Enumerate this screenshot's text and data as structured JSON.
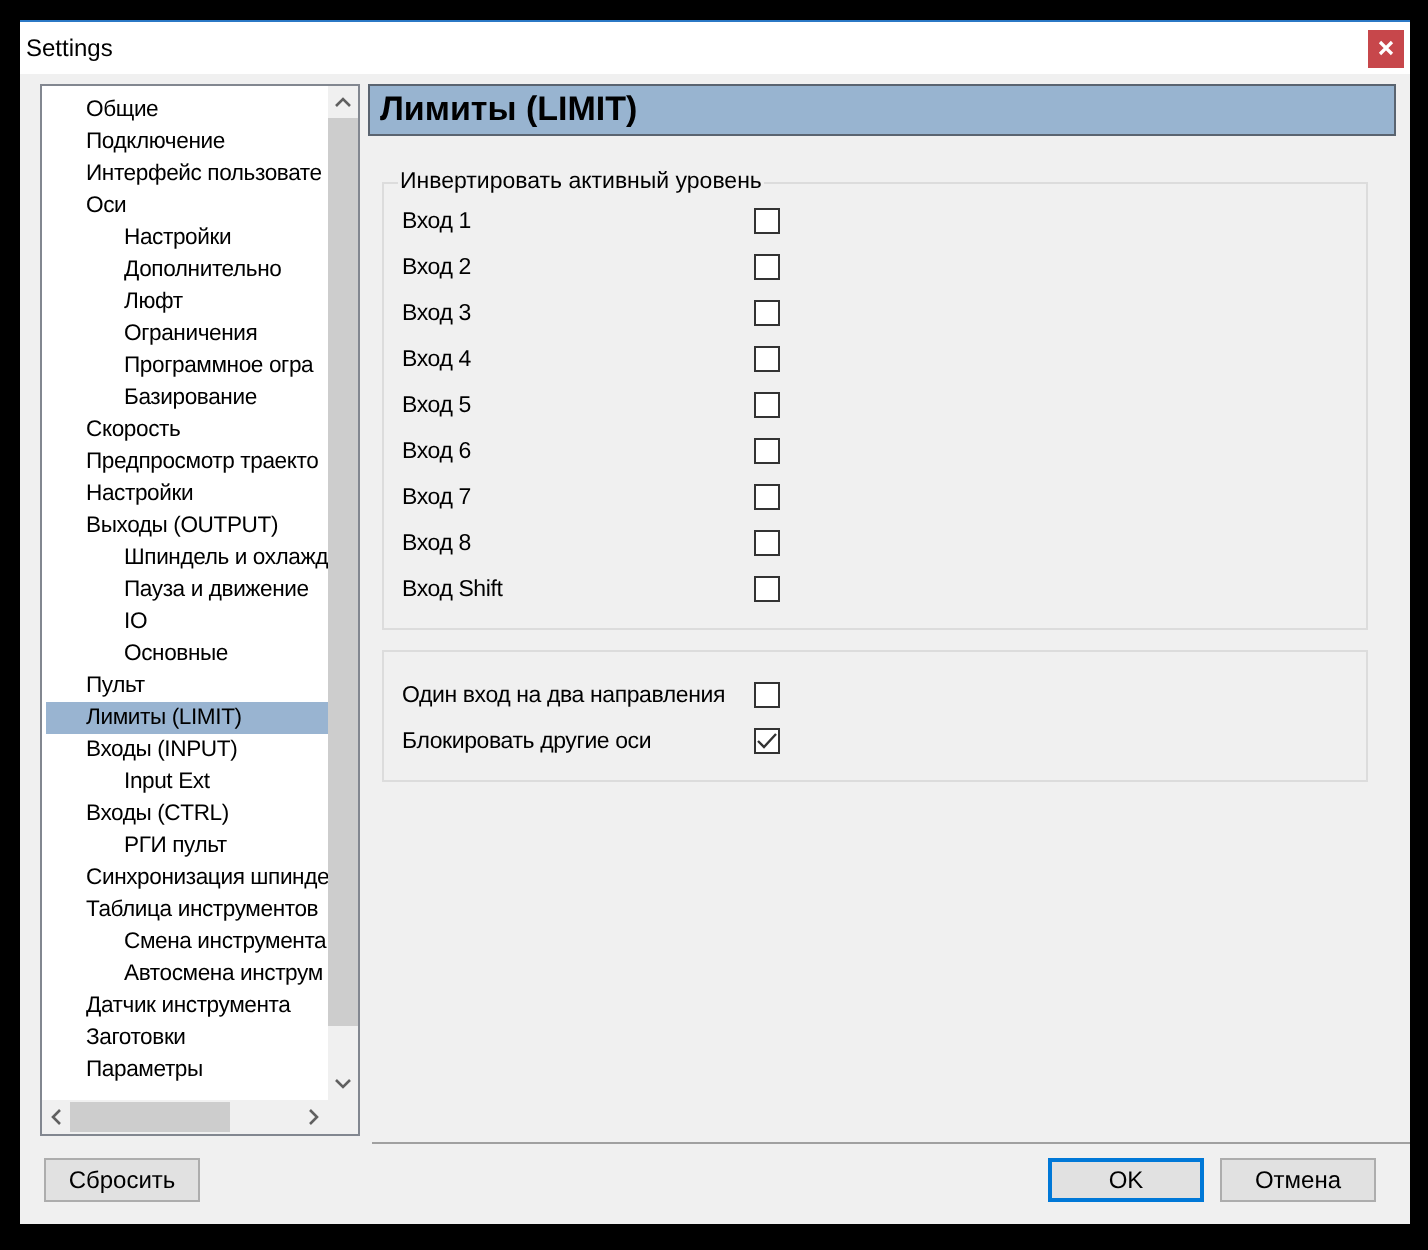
{
  "window": {
    "title": "Settings"
  },
  "tree": [
    {
      "label": "Общие",
      "selected": false
    },
    {
      "label": "Подключение",
      "selected": false
    },
    {
      "label": "Интерфейс пользовате",
      "selected": false
    },
    {
      "label": "Оси",
      "selected": false,
      "children": [
        {
          "label": "Настройки",
          "selected": false
        },
        {
          "label": "Дополнительно",
          "selected": false
        },
        {
          "label": "Люфт",
          "selected": false
        },
        {
          "label": "Ограничения",
          "selected": false
        },
        {
          "label": "Программное огра",
          "selected": false
        },
        {
          "label": "Базирование",
          "selected": false
        }
      ]
    },
    {
      "label": "Скорость",
      "selected": false
    },
    {
      "label": "Предпросмотр траекто",
      "selected": false
    },
    {
      "label": "Настройки",
      "selected": false
    },
    {
      "label": "Выходы (OUTPUT)",
      "selected": false,
      "children": [
        {
          "label": "Шпиндель и охлажд",
          "selected": false
        },
        {
          "label": "Пауза и движение",
          "selected": false
        },
        {
          "label": "IO",
          "selected": false
        },
        {
          "label": "Основные",
          "selected": false
        }
      ]
    },
    {
      "label": "Пульт",
      "selected": false
    },
    {
      "label": "Лимиты (LIMIT)",
      "selected": true
    },
    {
      "label": "Входы (INPUT)",
      "selected": false,
      "children": [
        {
          "label": "Input Ext",
          "selected": false
        }
      ]
    },
    {
      "label": "Входы (CTRL)",
      "selected": false,
      "children": [
        {
          "label": "РГИ пульт",
          "selected": false
        }
      ]
    },
    {
      "label": "Синхронизация шпинде",
      "selected": false
    },
    {
      "label": "Таблица инструментов",
      "selected": false,
      "children": [
        {
          "label": "Смена инструмента",
          "selected": false
        },
        {
          "label": "Автосмена инструм",
          "selected": false
        }
      ]
    },
    {
      "label": "Датчик инструмента",
      "selected": false
    },
    {
      "label": "Заготовки",
      "selected": false
    },
    {
      "label": "Параметры",
      "selected": false
    }
  ],
  "panel": {
    "title": "Лимиты (LIMIT)",
    "groups": [
      {
        "legend": "Инвертировать активный уровень",
        "options": [
          {
            "label": "Вход 1",
            "checked": false
          },
          {
            "label": "Вход 2",
            "checked": false
          },
          {
            "label": "Вход 3",
            "checked": false
          },
          {
            "label": "Вход 4",
            "checked": false
          },
          {
            "label": "Вход 5",
            "checked": false
          },
          {
            "label": "Вход 6",
            "checked": false
          },
          {
            "label": "Вход 7",
            "checked": false
          },
          {
            "label": "Вход 8",
            "checked": false
          },
          {
            "label": "Вход Shift",
            "checked": false
          }
        ]
      },
      {
        "options": [
          {
            "label": "Один вход на два направления",
            "checked": false
          },
          {
            "label": "Блокировать другие оси",
            "checked": true
          }
        ]
      }
    ]
  },
  "left_buttons": [
    {
      "label": "Сбросить",
      "focused": false
    }
  ],
  "right_buttons": [
    {
      "label": "OK",
      "focused": true
    },
    {
      "label": "Отмена",
      "focused": false
    }
  ]
}
